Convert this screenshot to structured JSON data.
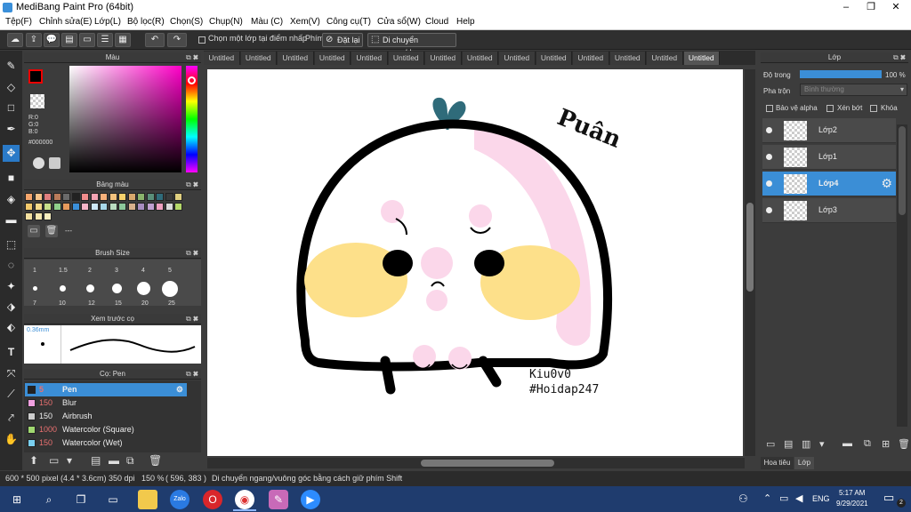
{
  "window": {
    "title": "MediBang Paint Pro (64bit)"
  },
  "menu": [
    "Tệp(F)",
    "Chỉnh sửa(E)",
    "Lớp(L)",
    "Bộ lọc(R)",
    "Chọn(S)",
    "Chụp(N)",
    "Màu (C)",
    "Xem(V)",
    "Công cụ(T)",
    "Cửa sổ(W)",
    "Cloud",
    "Help"
  ],
  "toolbar": {
    "snap_layer_checkbox": "Chọn một lớp tại điểm nhấp",
    "key_label": "Phím",
    "reset_button": "Đặt lại",
    "move_button": "Di chuyển ngang/dọc"
  },
  "tabs": [
    "Untitled",
    "Untitled",
    "Untitled",
    "Untitled",
    "Untitled",
    "Untitled",
    "Untitled",
    "Untitled",
    "Untitled",
    "Untitled",
    "Untitled",
    "Untitled",
    "Untitled",
    "Untitled"
  ],
  "color_panel": {
    "title": "Màu",
    "r": "R:0",
    "g": "G:0",
    "b": "B:0",
    "hex": "#000000"
  },
  "palette_panel": {
    "title": "Bảng màu",
    "footer": "---"
  },
  "brush_size_panel": {
    "title": "Brush Size",
    "top_sizes": [
      "1",
      "1.5",
      "2",
      "3",
      "4",
      "5"
    ],
    "bottom_sizes": [
      "7",
      "10",
      "12",
      "15",
      "20",
      "25"
    ]
  },
  "preview_panel": {
    "title": "Xem trước cọ",
    "size": "0.36mm"
  },
  "brush_panel": {
    "title": "Cọ: Pen",
    "items": [
      {
        "size": "5",
        "name": "Pen",
        "color": "#222222"
      },
      {
        "size": "150",
        "name": "Blur",
        "color": "#f0a0e0"
      },
      {
        "size": "150",
        "name": "Airbrush",
        "color": "#cccccc"
      },
      {
        "size": "1000",
        "name": "Watercolor (Square)",
        "color": "#a0d870"
      },
      {
        "size": "150",
        "name": "Watercolor (Wet)",
        "color": "#7ad0f0"
      }
    ]
  },
  "layer_panel": {
    "title": "Lớp",
    "opacity_label": "Độ trong",
    "opacity_value": "100 %",
    "opacity": 1.0,
    "blend_label": "Pha trộn",
    "blend_value": "Bình thường",
    "protect_alpha": "Bảo vệ alpha",
    "clipping": "Xén bớt",
    "lock": "Khóa",
    "layers": [
      "Lớp2",
      "Lớp1",
      "Lớp4",
      "Lớp3"
    ],
    "bottom_tabs": [
      "Hoa tiêu",
      "Lớp"
    ]
  },
  "canvas": {
    "signature": "Puân",
    "credit_line1": "Kiu0v0",
    "credit_line2": "#Hoidap247"
  },
  "status": {
    "size": "600 * 500 pixel",
    "cm": "(4.4 * 3.6cm)",
    "dpi": "350 dpi",
    "zoom": "150 %",
    "coords": "( 596, 383 )",
    "hint": "Di chuyển ngang/vuông góc bằng cách giữ phím Shift"
  },
  "taskbar": {
    "lang": "ENG",
    "time": "5:17 AM",
    "date": "9/29/2021",
    "notif": "2"
  },
  "colors": {
    "accent": "#3b8ed6",
    "cheek": "#fde08a",
    "blush": "#fbd7ea",
    "sprout": "#2f6b7a"
  }
}
